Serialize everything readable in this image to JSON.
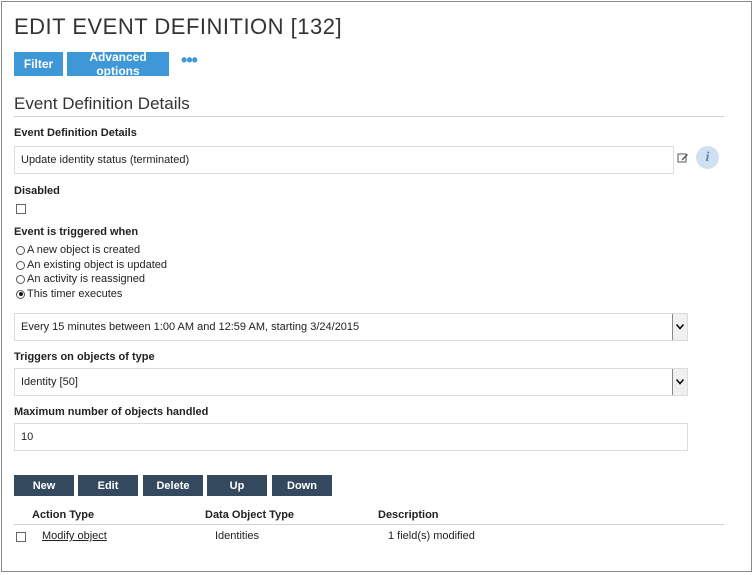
{
  "page": {
    "title": "EDIT EVENT DEFINITION [132]"
  },
  "toolbar": {
    "filter_label": "Filter",
    "advanced_label": "Advanced options",
    "more_label": "•••"
  },
  "section": {
    "title": "Event Definition Details"
  },
  "fields": {
    "details_label": "Event Definition Details",
    "details_value": "Update identity status (terminated)",
    "info_glyph": "i",
    "disabled_label": "Disabled",
    "disabled_checked": false,
    "trigger_label": "Event is triggered when",
    "trigger_options": [
      {
        "label": "A new object is created",
        "checked": false
      },
      {
        "label": "An existing object is updated",
        "checked": false
      },
      {
        "label": "An activity is reassigned",
        "checked": false
      },
      {
        "label": "This timer executes",
        "checked": true
      }
    ],
    "schedule_value": "Every 15 minutes between 1:00 AM and 12:59 AM, starting 3/24/2015",
    "object_type_label": "Triggers on objects of type",
    "object_type_value": "Identity [50]",
    "max_label": "Maximum number of objects handled",
    "max_value": "10"
  },
  "actions": {
    "new_label": "New",
    "edit_label": "Edit",
    "delete_label": "Delete",
    "up_label": "Up",
    "down_label": "Down"
  },
  "table": {
    "headers": {
      "action_type": "Action Type",
      "data_object_type": "Data Object Type",
      "description": "Description"
    },
    "rows": [
      {
        "action_type": "Modify object",
        "data_object_type": "Identities",
        "description": "1 field(s) modified"
      }
    ]
  },
  "icons": {
    "edit": "edit-icon",
    "info": "info-icon",
    "dropdown": "chevron-down-icon"
  },
  "colors": {
    "toolbar_button": "#3e97d6",
    "action_button": "#34495e",
    "info_bg": "#cfe0f2"
  }
}
